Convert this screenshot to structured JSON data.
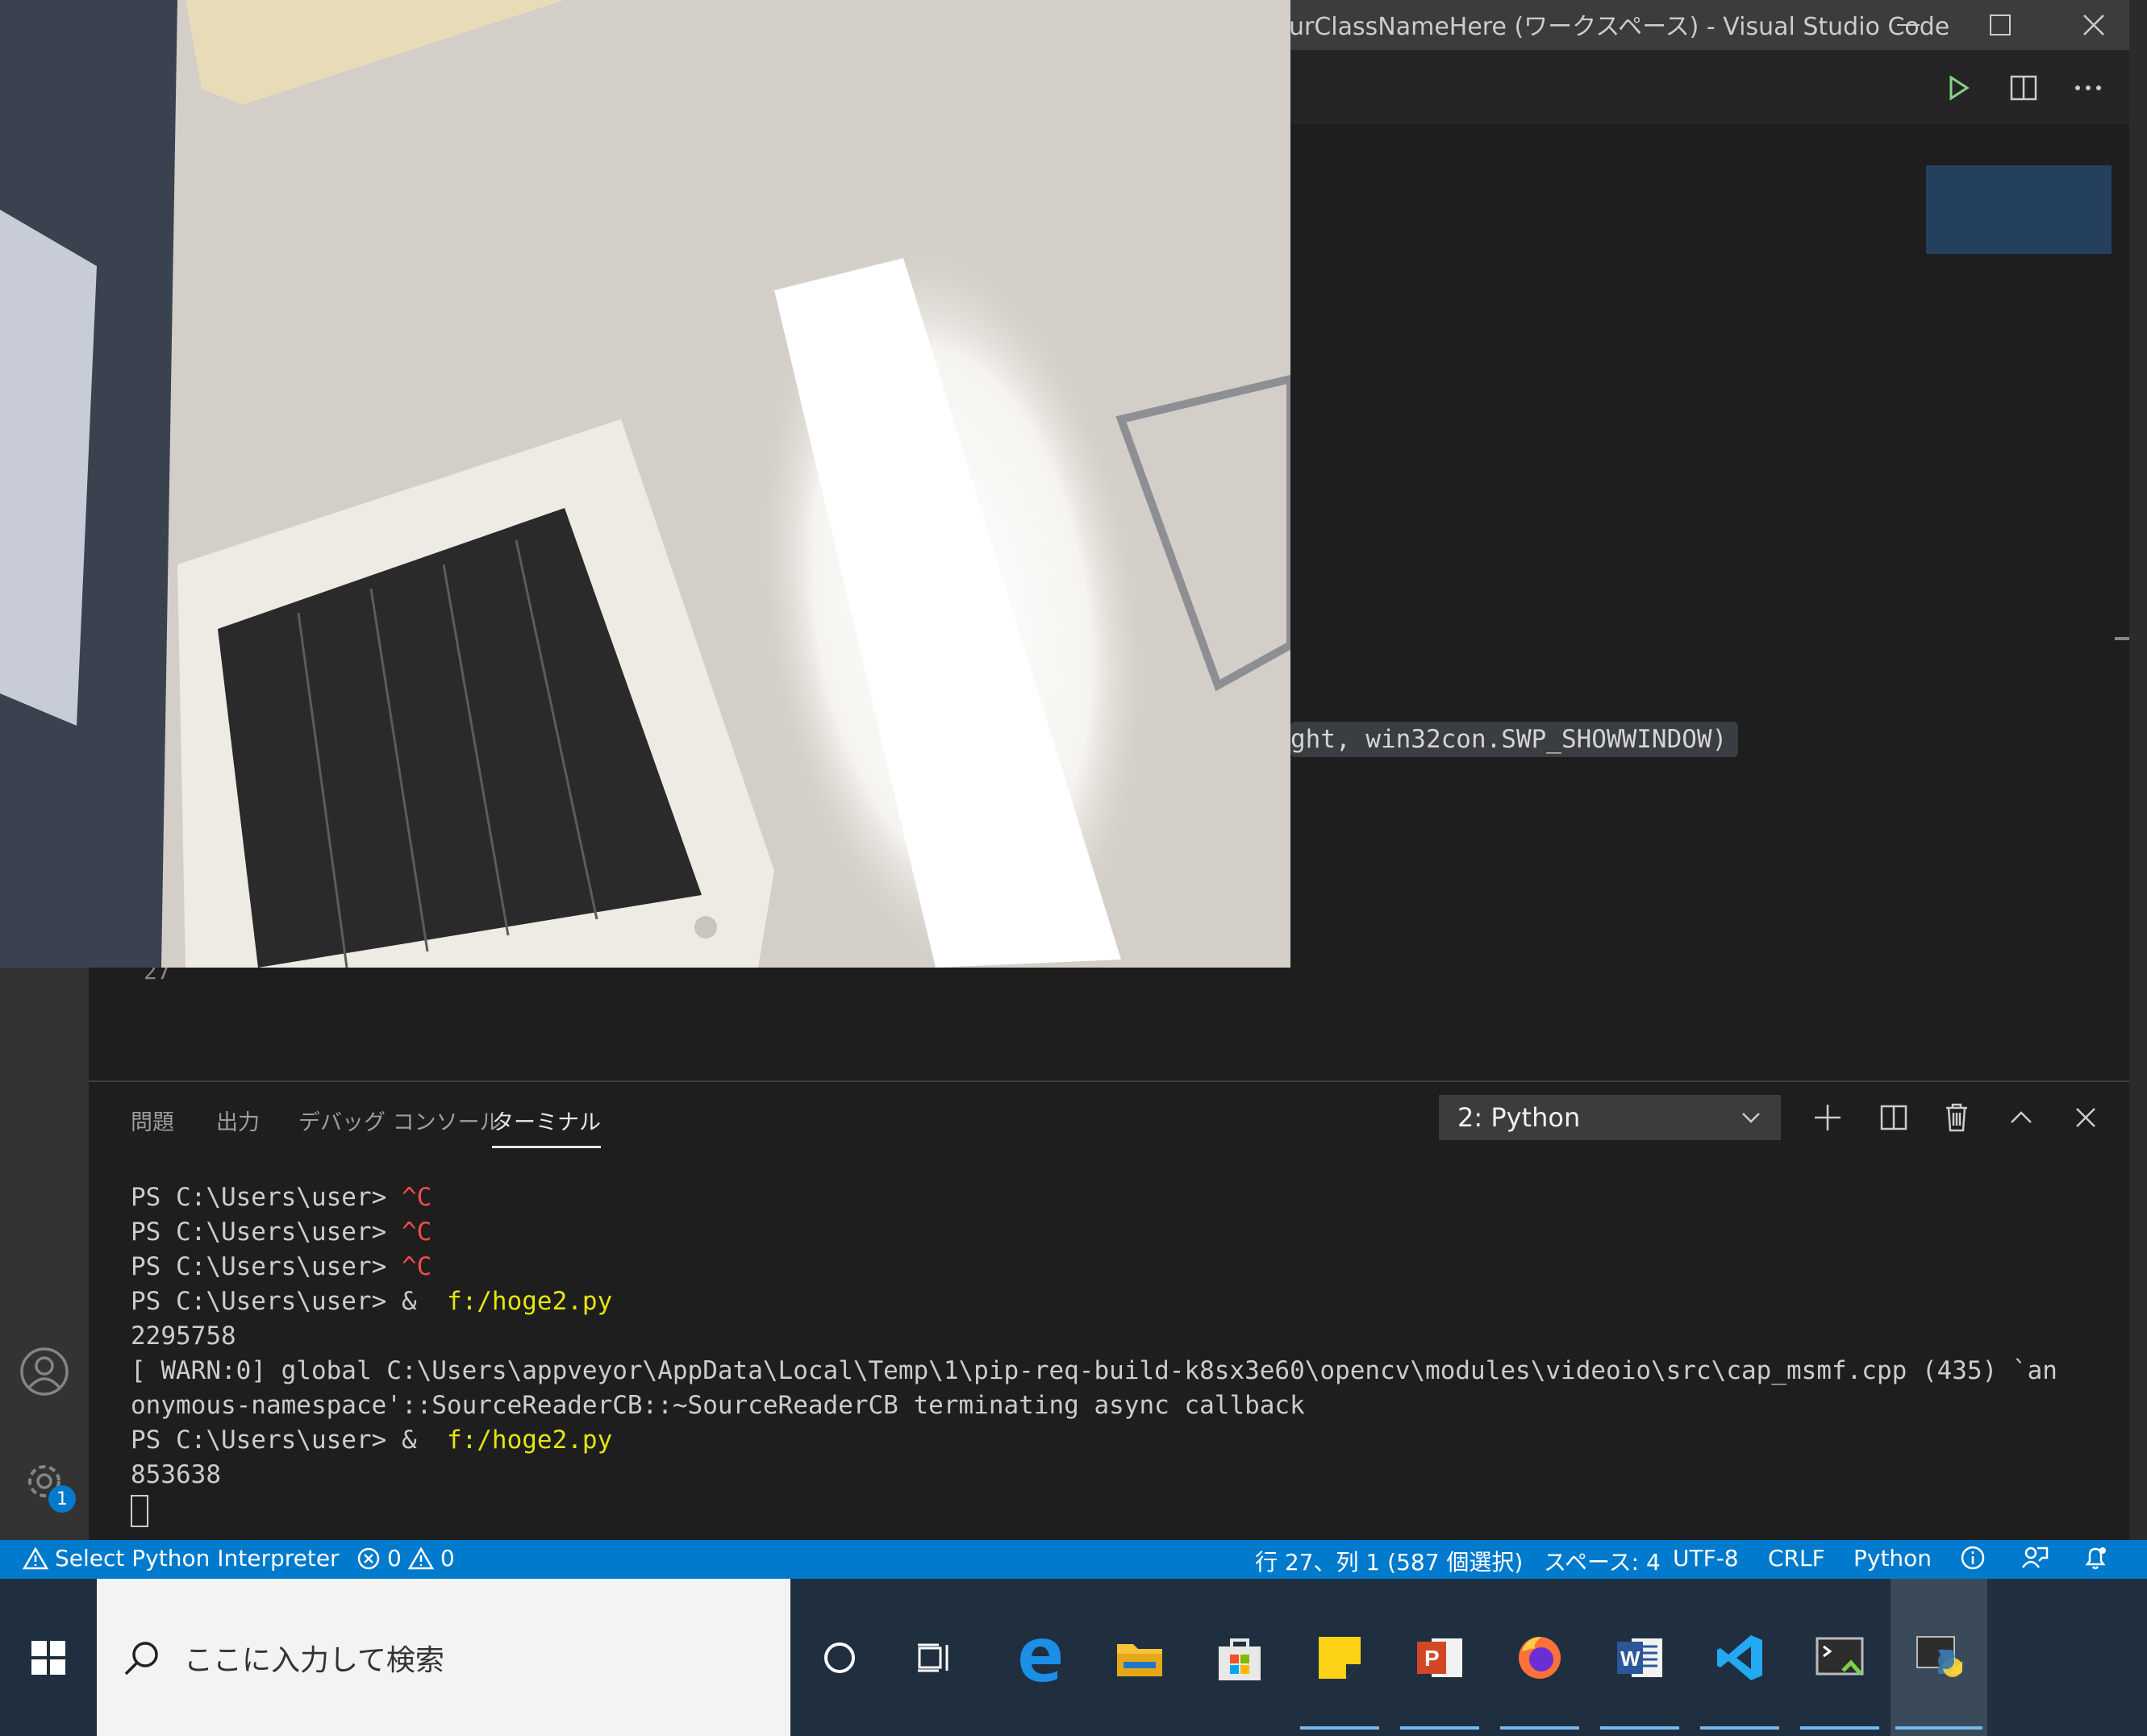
{
  "window": {
    "title": "urClassNameHere (ワークスペース) - Visual Studio Code",
    "minimize_icon": "minimize-icon",
    "maximize_icon": "maximize-icon",
    "close_icon": "close-icon"
  },
  "editor": {
    "visible_code": "ght, win32con.SWP_SHOWWINDOW)",
    "line_number": "27",
    "toolbar_icons": [
      "run-icon",
      "split-editor-icon",
      "more-actions-icon"
    ]
  },
  "panel": {
    "tabs": [
      {
        "label": "問題"
      },
      {
        "label": "出力"
      },
      {
        "label": "デバッグ コンソール"
      },
      {
        "label": "ターミナル"
      }
    ],
    "active_tab": "ターミナル",
    "terminal_selector": "2: Python"
  },
  "terminal": {
    "prompt": "PS C:\\Users\\user> ",
    "ctrl_c": "^C",
    "amp": "& ",
    "command": " f:/hoge2.py",
    "output1": "2295758",
    "warn_line1": "[ WARN:0] global C:\\Users\\appveyor\\AppData\\Local\\Temp\\1\\pip-req-build-k8sx3e60\\opencv\\modules\\videoio\\src\\cap_msmf.cpp (435) `an",
    "warn_line2": "onymous-namespace'::SourceReaderCB::~SourceReaderCB terminating async callback",
    "output2": "853638"
  },
  "statusbar": {
    "interpreter": "Select Python Interpreter",
    "errors": "0",
    "warnings": "0",
    "position": "行 27、列 1 (587 個選択)",
    "spaces": "スペース: 4",
    "encoding": "UTF-8",
    "eol": "CRLF",
    "language": "Python"
  },
  "activity": {
    "settings_badge": "1"
  },
  "taskbar": {
    "search_placeholder": "ここに入力して検索",
    "apps": [
      "edge-icon",
      "file-explorer-icon",
      "store-icon",
      "sticky-notes-icon",
      "powerpoint-icon",
      "firefox-icon",
      "word-icon",
      "vscode-icon",
      "terminal-icon",
      "python-icon"
    ]
  },
  "colors": {
    "statusbar": "#007acc",
    "editor_bg": "#1e1e1e",
    "ctrl_c": "#f14c4c",
    "command": "#e5e510"
  }
}
